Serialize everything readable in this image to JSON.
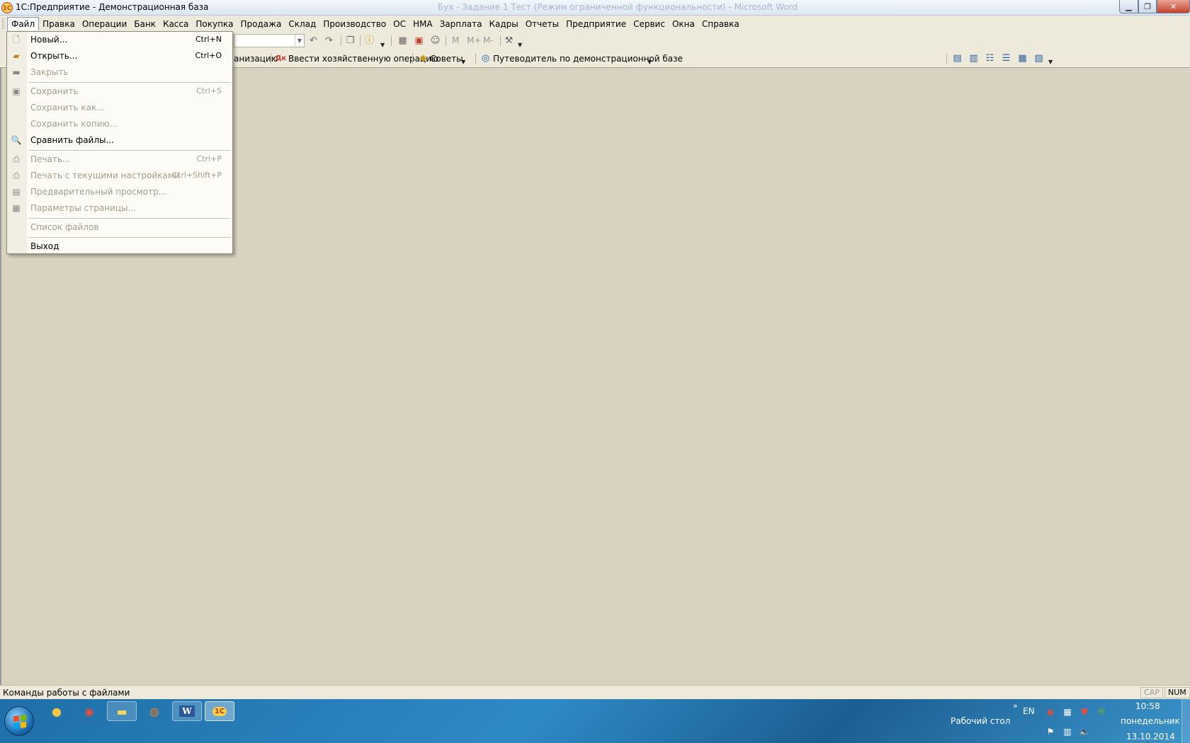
{
  "window": {
    "title": "1С:Предприятие - Демонстрационная база",
    "background_title": "Бух - Задание 1 Тест (Режим ограниченной функциональности) - Microsoft Word",
    "app_icon_text": "1С",
    "controls": {
      "minimize": "▁",
      "maximize": "❐",
      "close": "✕"
    }
  },
  "menubar": {
    "items": [
      "Файл",
      "Правка",
      "Операции",
      "Банк",
      "Касса",
      "Покупка",
      "Продажа",
      "Склад",
      "Производство",
      "ОС",
      "НМА",
      "Зарплата",
      "Кадры",
      "Отчеты",
      "Предприятие",
      "Сервис",
      "Окна",
      "Справка"
    ],
    "active": "Файл"
  },
  "toolbar1": {
    "buttons": {
      "m": "M",
      "m_plus": "M+",
      "m_minus": "M-"
    }
  },
  "toolbar2": {
    "truncated_label": "анизацию",
    "operation_label": "Ввести хозяйственную операцию",
    "operation_icon_text": "Дк",
    "tips_label": "Советы",
    "guide_label": "Путеводитель по демонстрационной базе"
  },
  "file_menu": {
    "items": [
      {
        "label": "Новый...",
        "shortcut": "Ctrl+N",
        "enabled": true,
        "icon": "new-document-icon"
      },
      {
        "label": "Открыть...",
        "shortcut": "Ctrl+O",
        "enabled": true,
        "icon": "open-folder-icon"
      },
      {
        "label": "Закрыть",
        "shortcut": "",
        "enabled": false,
        "icon": "close-document-icon"
      },
      {
        "label": "Сохранить",
        "shortcut": "Ctrl+S",
        "enabled": false,
        "icon": "save-icon"
      },
      {
        "label": "Сохранить как...",
        "shortcut": "",
        "enabled": false,
        "icon": ""
      },
      {
        "label": "Сохранить копию...",
        "shortcut": "",
        "enabled": false,
        "icon": ""
      },
      {
        "label": "Сравнить файлы...",
        "shortcut": "",
        "enabled": true,
        "icon": "compare-files-icon"
      },
      {
        "label": "Печать...",
        "shortcut": "Ctrl+P",
        "enabled": false,
        "icon": "print-icon"
      },
      {
        "label": "Печать с текущими настройками",
        "shortcut": "Ctrl+Shift+P",
        "enabled": false,
        "icon": "print-current-icon"
      },
      {
        "label": "Предварительный просмотр...",
        "shortcut": "",
        "enabled": false,
        "icon": "print-preview-icon"
      },
      {
        "label": "Параметры страницы...",
        "shortcut": "",
        "enabled": false,
        "icon": "page-setup-icon"
      },
      {
        "label": "Список файлов",
        "shortcut": "",
        "enabled": false,
        "icon": ""
      },
      {
        "label": "Выход",
        "shortcut": "",
        "enabled": true,
        "icon": ""
      }
    ]
  },
  "statusbar": {
    "text": "Команды работы с файлами",
    "cap": "CAP",
    "num": "NUM"
  },
  "taskbar": {
    "word_label": "W",
    "onec_label": "1С",
    "desktop_label": "Рабочий стол",
    "expand_label": "»",
    "language": "EN",
    "time": "10:58",
    "day": "понедельник",
    "date": "13.10.2014"
  }
}
